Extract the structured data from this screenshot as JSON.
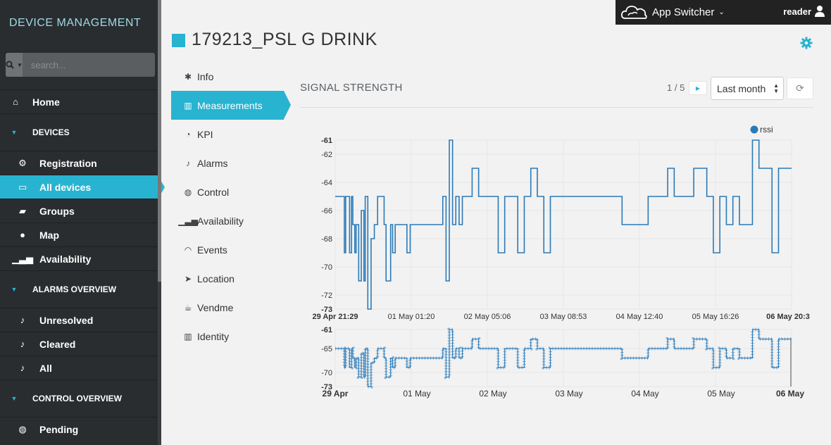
{
  "sidebar": {
    "brand": "DEVICE MANAGEMENT",
    "search_placeholder": "search...",
    "items": [
      {
        "type": "row",
        "label": "Home",
        "icon": "home-icon",
        "glyph": "⌂"
      },
      {
        "type": "section",
        "label": "DEVICES"
      },
      {
        "type": "row",
        "sub": true,
        "label": "Registration",
        "icon": "cogs-icon",
        "glyph": "⚙"
      },
      {
        "type": "row",
        "sub": true,
        "label": "All devices",
        "icon": "inbox-icon",
        "glyph": "▭",
        "active": true
      },
      {
        "type": "row",
        "sub": true,
        "label": "Groups",
        "icon": "folder-icon",
        "glyph": "▰"
      },
      {
        "type": "row",
        "sub": true,
        "label": "Map",
        "icon": "map-marker-icon",
        "glyph": "●"
      },
      {
        "type": "row",
        "sub": true,
        "label": "Availability",
        "icon": "signal-icon",
        "glyph": "▁▃▅"
      },
      {
        "type": "section",
        "label": "ALARMS OVERVIEW"
      },
      {
        "type": "row",
        "sub": true,
        "label": "Unresolved",
        "icon": "bell-icon",
        "glyph": "♪"
      },
      {
        "type": "row",
        "sub": true,
        "label": "Cleared",
        "icon": "bell-icon",
        "glyph": "♪"
      },
      {
        "type": "row",
        "sub": true,
        "label": "All",
        "icon": "bell-icon",
        "glyph": "♪"
      },
      {
        "type": "section",
        "label": "CONTROL OVERVIEW"
      },
      {
        "type": "row",
        "sub": true,
        "label": "Pending",
        "icon": "gamepad-icon",
        "glyph": "◍"
      }
    ]
  },
  "topbar": {
    "app_switcher": "App Switcher",
    "user": "reader"
  },
  "page": {
    "title": "179213_PSL G DRINK"
  },
  "tabs": [
    {
      "label": "Info",
      "icon": "asterisk-icon",
      "glyph": "✱"
    },
    {
      "label": "Measurements",
      "icon": "bar-chart-icon",
      "glyph": "▥",
      "active": true
    },
    {
      "label": "KPI",
      "icon": "dashboard-icon",
      "glyph": "◔"
    },
    {
      "label": "Alarms",
      "icon": "bell-icon",
      "glyph": "♪"
    },
    {
      "label": "Control",
      "icon": "gamepad-icon",
      "glyph": "◍"
    },
    {
      "label": "Availability",
      "icon": "signal-icon",
      "glyph": "▁▃▅"
    },
    {
      "label": "Events",
      "icon": "rss-icon",
      "glyph": "◠"
    },
    {
      "label": "Location",
      "icon": "location-arrow-icon",
      "glyph": "➤"
    },
    {
      "label": "Vendme",
      "icon": "coffee-icon",
      "glyph": "☕"
    },
    {
      "label": "Identity",
      "icon": "barcode-icon",
      "glyph": "▥"
    }
  ],
  "measurement": {
    "section_title": "SIGNAL STRENGTH",
    "pager": "1 / 5",
    "range": "Last month"
  },
  "colors": {
    "accent": "#28b3d1",
    "series": "#2a7ab8",
    "sidebar_bg": "#2a2d2f"
  },
  "chart_data": [
    {
      "type": "line",
      "series": [
        {
          "name": "rssi"
        }
      ],
      "legend": "top-right",
      "grid": true,
      "ylim": [
        -73,
        -61
      ],
      "y_ticks": [
        "-61",
        "-62",
        "-64",
        "-66",
        "-68",
        "-70",
        "-72",
        "-73"
      ],
      "x_ticks": [
        "29 Apr 21:29",
        "01 May 01:20",
        "02 May 05:06",
        "03 May 08:53",
        "04 May 12:40",
        "05 May 16:26",
        "06 May 20:3"
      ],
      "x": [
        0,
        0.1,
        0.13,
        0.14,
        0.16,
        0.18,
        0.22,
        0.25,
        0.27,
        0.3,
        0.32,
        0.36,
        0.4,
        0.44,
        0.46,
        0.5,
        0.55,
        0.6,
        0.65,
        0.69,
        0.75,
        0.78,
        0.85,
        0.88,
        0.92,
        0.96,
        1.0,
        1.05,
        1.1,
        1.15,
        1.2,
        1.25,
        1.3,
        1.35,
        1.4,
        1.45,
        1.5,
        1.55,
        1.6,
        1.65,
        1.7,
        1.75,
        1.8,
        1.85,
        1.9,
        1.95,
        2.0,
        2.1,
        2.2,
        2.3,
        2.4,
        2.5,
        2.6,
        2.7,
        2.8,
        2.9,
        3.0,
        3.1,
        3.2,
        3.3,
        3.4,
        3.5,
        3.6,
        3.7,
        3.8,
        3.9,
        4.0,
        4.1,
        4.2,
        4.3,
        4.4,
        4.5,
        4.6,
        4.7,
        4.8,
        4.9,
        5.0,
        5.1,
        5.2,
        5.3,
        5.4,
        5.5,
        5.6,
        5.7,
        5.8,
        5.9,
        6.0,
        6.1,
        6.2,
        6.3,
        6.4,
        6.5,
        6.6,
        6.7,
        6.8,
        6.9,
        7.0
      ],
      "y": [
        -65,
        -65,
        -65,
        -69,
        -65,
        -65,
        -69,
        -65,
        -67,
        -69,
        -67,
        -71,
        -66,
        -71,
        -65,
        -73,
        -68,
        -67,
        -65,
        -65,
        -67,
        -71,
        -67,
        -69,
        -67,
        -67,
        -67,
        -67,
        -69,
        -67,
        -67,
        -67,
        -67,
        -67,
        -67,
        -67,
        -67,
        -67,
        -67,
        -65,
        -71,
        -61,
        -67,
        -65,
        -67,
        -65,
        -65,
        -63,
        -65,
        -65,
        -65,
        -69,
        -65,
        -65,
        -69,
        -65,
        -63,
        -65,
        -69,
        -65,
        -65,
        -65,
        -65,
        -65,
        -65,
        -65,
        -65,
        -65,
        -65,
        -65,
        -67,
        -67,
        -67,
        -67,
        -65,
        -65,
        -65,
        -63,
        -65,
        -65,
        -65,
        -63,
        -63,
        -65,
        -69,
        -65,
        -67,
        -65,
        -67,
        -67,
        -61,
        -63,
        -63,
        -69,
        -63,
        -63,
        -63
      ]
    },
    {
      "type": "line",
      "role": "navigator",
      "ylim": [
        -73,
        -61
      ],
      "y_ticks": [
        "-61",
        "-65",
        "-70",
        "-73"
      ],
      "x_ticks": [
        "29 Apr",
        "01 May",
        "02 May",
        "03 May",
        "04 May",
        "05 May",
        "06 May"
      ]
    }
  ]
}
